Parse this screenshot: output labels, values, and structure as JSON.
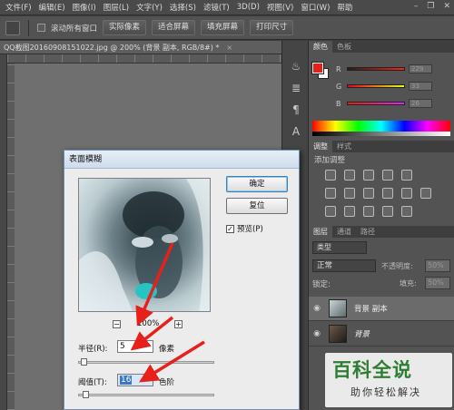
{
  "menu": {
    "items": [
      "文件(F)",
      "编辑(E)",
      "图像(I)",
      "图层(L)",
      "文字(Y)",
      "选择(S)",
      "滤镜(T)",
      "3D(D)",
      "视图(V)",
      "窗口(W)",
      "帮助"
    ]
  },
  "options_bar": {
    "scroll_all_label": "滚动所有窗口",
    "actual_pixels": "实际像素",
    "fit_screen": "适合屏幕",
    "fill_screen": "填充屏幕",
    "print_size": "打印尺寸"
  },
  "document": {
    "tab_title": "QQ截图20160908151022.jpg @ 200% (背景 副本, RGB/8#) *",
    "close_glyph": "×"
  },
  "color_panel": {
    "tabs": [
      "颜色",
      "色板"
    ],
    "channels": [
      {
        "label": "R",
        "value": "229"
      },
      {
        "label": "G",
        "value": "33"
      },
      {
        "label": "B",
        "value": "26"
      }
    ],
    "foreground": "#e5211a",
    "background": "#ffffff"
  },
  "adjust_panel": {
    "tabs": [
      "调整",
      "样式"
    ],
    "heading": "添加调整"
  },
  "layers_panel": {
    "tabs": [
      "图层",
      "通道",
      "路径"
    ],
    "kind_filter": "类型",
    "blend_mode": "正常",
    "opacity_label": "不透明度:",
    "opacity_value": "50%",
    "lock_label": "锁定:",
    "fill_label": "填充:",
    "fill_value": "50%",
    "layers": [
      {
        "name": "背景 副本",
        "selected": true
      },
      {
        "name": "背景",
        "selected": false
      }
    ]
  },
  "dialog": {
    "title": "表面模糊",
    "ok_label": "确定",
    "reset_label": "复位",
    "preview_label": "预览(P)",
    "preview_checked": "✓",
    "zoom_value": "100%",
    "zoom_minus": "−",
    "zoom_plus": "+",
    "radius_label": "半径(R):",
    "radius_value": "5",
    "radius_unit": "像素",
    "threshold_label": "阈值(T):",
    "threshold_value": "16",
    "threshold_unit": "色阶"
  },
  "watermark": {
    "title": "百科全说",
    "subtitle": "助你轻松解决"
  }
}
